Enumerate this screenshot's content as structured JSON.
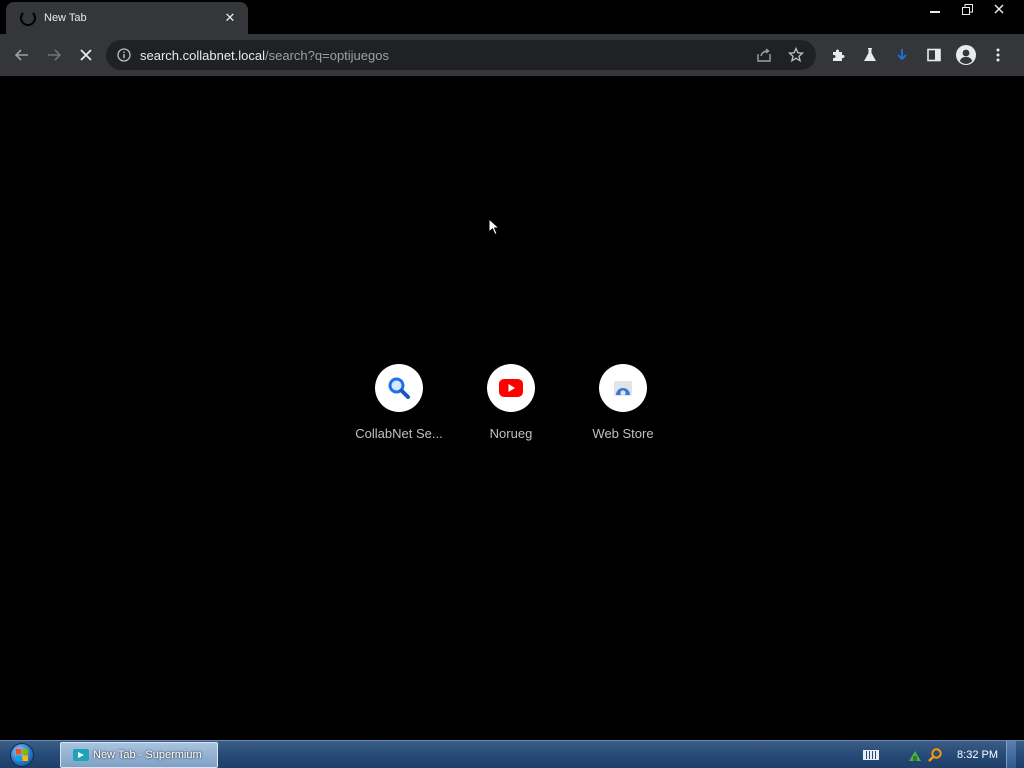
{
  "tab": {
    "title": "New Tab",
    "close_label": "✕"
  },
  "window": {
    "minimize": "—",
    "restore": "❐",
    "close": "✕"
  },
  "omnibox": {
    "host": "search.collabnet.local",
    "path": "/search?q=optijuegos"
  },
  "shortcuts": [
    {
      "label": "CollabNet Se...",
      "icon": "search-icon"
    },
    {
      "label": "Norueg",
      "icon": "youtube-icon"
    },
    {
      "label": "Web Store",
      "icon": "web-store-icon"
    }
  ],
  "taskbar": {
    "item_label": "New Tab - Supermium",
    "clock": "8:32 PM"
  },
  "colors": {
    "toolbar": "#35363a",
    "omnibox": "#202124",
    "youtube_red": "#ff0000",
    "search_blue": "#1a73e8"
  }
}
